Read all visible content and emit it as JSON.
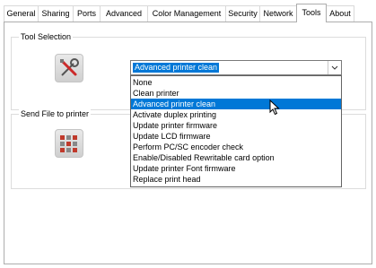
{
  "tabs": [
    {
      "label": "General",
      "active": false
    },
    {
      "label": "Sharing",
      "active": false
    },
    {
      "label": "Ports",
      "active": false
    },
    {
      "label": "Advanced",
      "active": false
    },
    {
      "label": "Color Management",
      "active": false
    },
    {
      "label": "Security",
      "active": false
    },
    {
      "label": "Network",
      "active": false
    },
    {
      "label": "Tools",
      "active": true
    },
    {
      "label": "About",
      "active": false
    }
  ],
  "tool_selection": {
    "title": "Tool Selection",
    "icon": "tools-icon",
    "selected_value": "Advanced printer clean",
    "options": [
      "None",
      "Clean printer",
      "Advanced printer clean",
      "Activate duplex printing",
      "Update printer firmware",
      "Update LCD firmware",
      "Perform PC/SC encoder check",
      "Enable/Disabled Rewritable card option",
      "Update printer Font firmware",
      "Replace print head"
    ],
    "highlighted_index": 2
  },
  "send_file": {
    "title": "Send File to printer",
    "icon": "file-grid-icon"
  },
  "colors": {
    "selection": "#0078d7",
    "tool_icon_red": "#cc2a2a",
    "grid_icon_red": "#c0392b"
  }
}
